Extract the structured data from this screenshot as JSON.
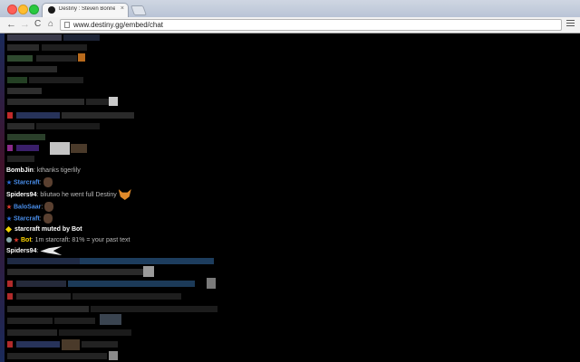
{
  "browser": {
    "tab_title": "Destiny : Steven Bonnell II",
    "tab_close": "×",
    "url": "www.destiny.gg/embed/chat",
    "nav_back": "←",
    "nav_forward": "→",
    "nav_reload": "C",
    "nav_home": "⌂"
  },
  "chat": {
    "messages": [
      {
        "user": "BombJin",
        "separator": ": ",
        "text": "kthanks tigerlily"
      },
      {
        "user": "Starcraft",
        "separator": ": ",
        "text": ""
      },
      {
        "user": "Spiders94",
        "separator": ": ",
        "text": "bliutwo he went full Destiny"
      },
      {
        "user": "BaloSaar",
        "separator": ": ",
        "text": ""
      },
      {
        "user": "Starcraft",
        "separator": ": ",
        "text": ""
      },
      {
        "user": "",
        "separator": "",
        "text": "starcraft muted by Bot"
      },
      {
        "user": "Bot",
        "separator": ": ",
        "text": "1m starcraft: 81% = your past text"
      },
      {
        "user": "Spiders94",
        "separator": ": ",
        "text": ""
      }
    ]
  },
  "colors": {
    "chat_bg": "#000000",
    "username_white": "#ffffff",
    "username_blue": "#488ce7",
    "bot_gold": "#ffd700",
    "message_text": "#b9b9b9"
  }
}
